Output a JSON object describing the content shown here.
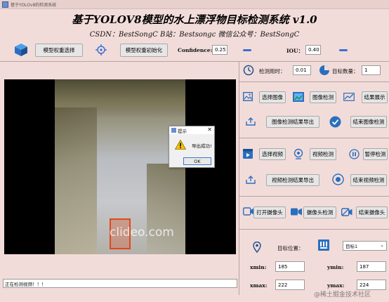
{
  "window": {
    "title": "基于YOLOv8的检测系统"
  },
  "header": {
    "title": "基于YOLOV8模型的水上漂浮物目标检测系统 v1.0",
    "subtitle": "CSDN：BestSongC   B站：Bestsongc   微信公众号：BestSongC"
  },
  "toolbar": {
    "select_weights": "模型权重选择",
    "init_weights": "模型权重初始化",
    "confidence_label": "Confidence:",
    "confidence_value": "0.25",
    "iou_label": "IOU：",
    "iou_value": "0.40"
  },
  "stats": {
    "time_label": "检测用时：",
    "time_value": "0.01",
    "count_label": "目标数量：",
    "count_value": "1"
  },
  "image_section": {
    "select": "选择图像",
    "detect": "图像检测",
    "show": "结果展示",
    "export": "图像检测结果导出",
    "stop": "结束图像检测"
  },
  "video_section": {
    "select": "选择视频",
    "detect": "视频检测",
    "pause": "暂停检测",
    "export": "视频检测结果导出",
    "stop": "结束视频检测"
  },
  "camera_section": {
    "open": "打开摄像头",
    "detect": "摄像头检测",
    "close": "结束摄像头"
  },
  "target": {
    "label": "目标位置：",
    "select_value": "目标1",
    "xmin_label": "xmin:",
    "xmin_value": "185",
    "ymin_label": "ymin:",
    "ymin_value": "187",
    "xmax_label": "xmax:",
    "xmax_value": "222",
    "ymax_label": "ymax:",
    "ymax_value": "224"
  },
  "video": {
    "watermark": "clideo.com"
  },
  "dialog": {
    "title": "提示",
    "message": "导出成功!",
    "ok": "OK",
    "close": "✕"
  },
  "status": {
    "text": "正在检测视频！！！"
  },
  "footer_watermark": "@稀土掘金技术社区",
  "colors": {
    "accent": "#3b6fd6",
    "background": "#f2dcd9",
    "box": "#e0481f"
  }
}
